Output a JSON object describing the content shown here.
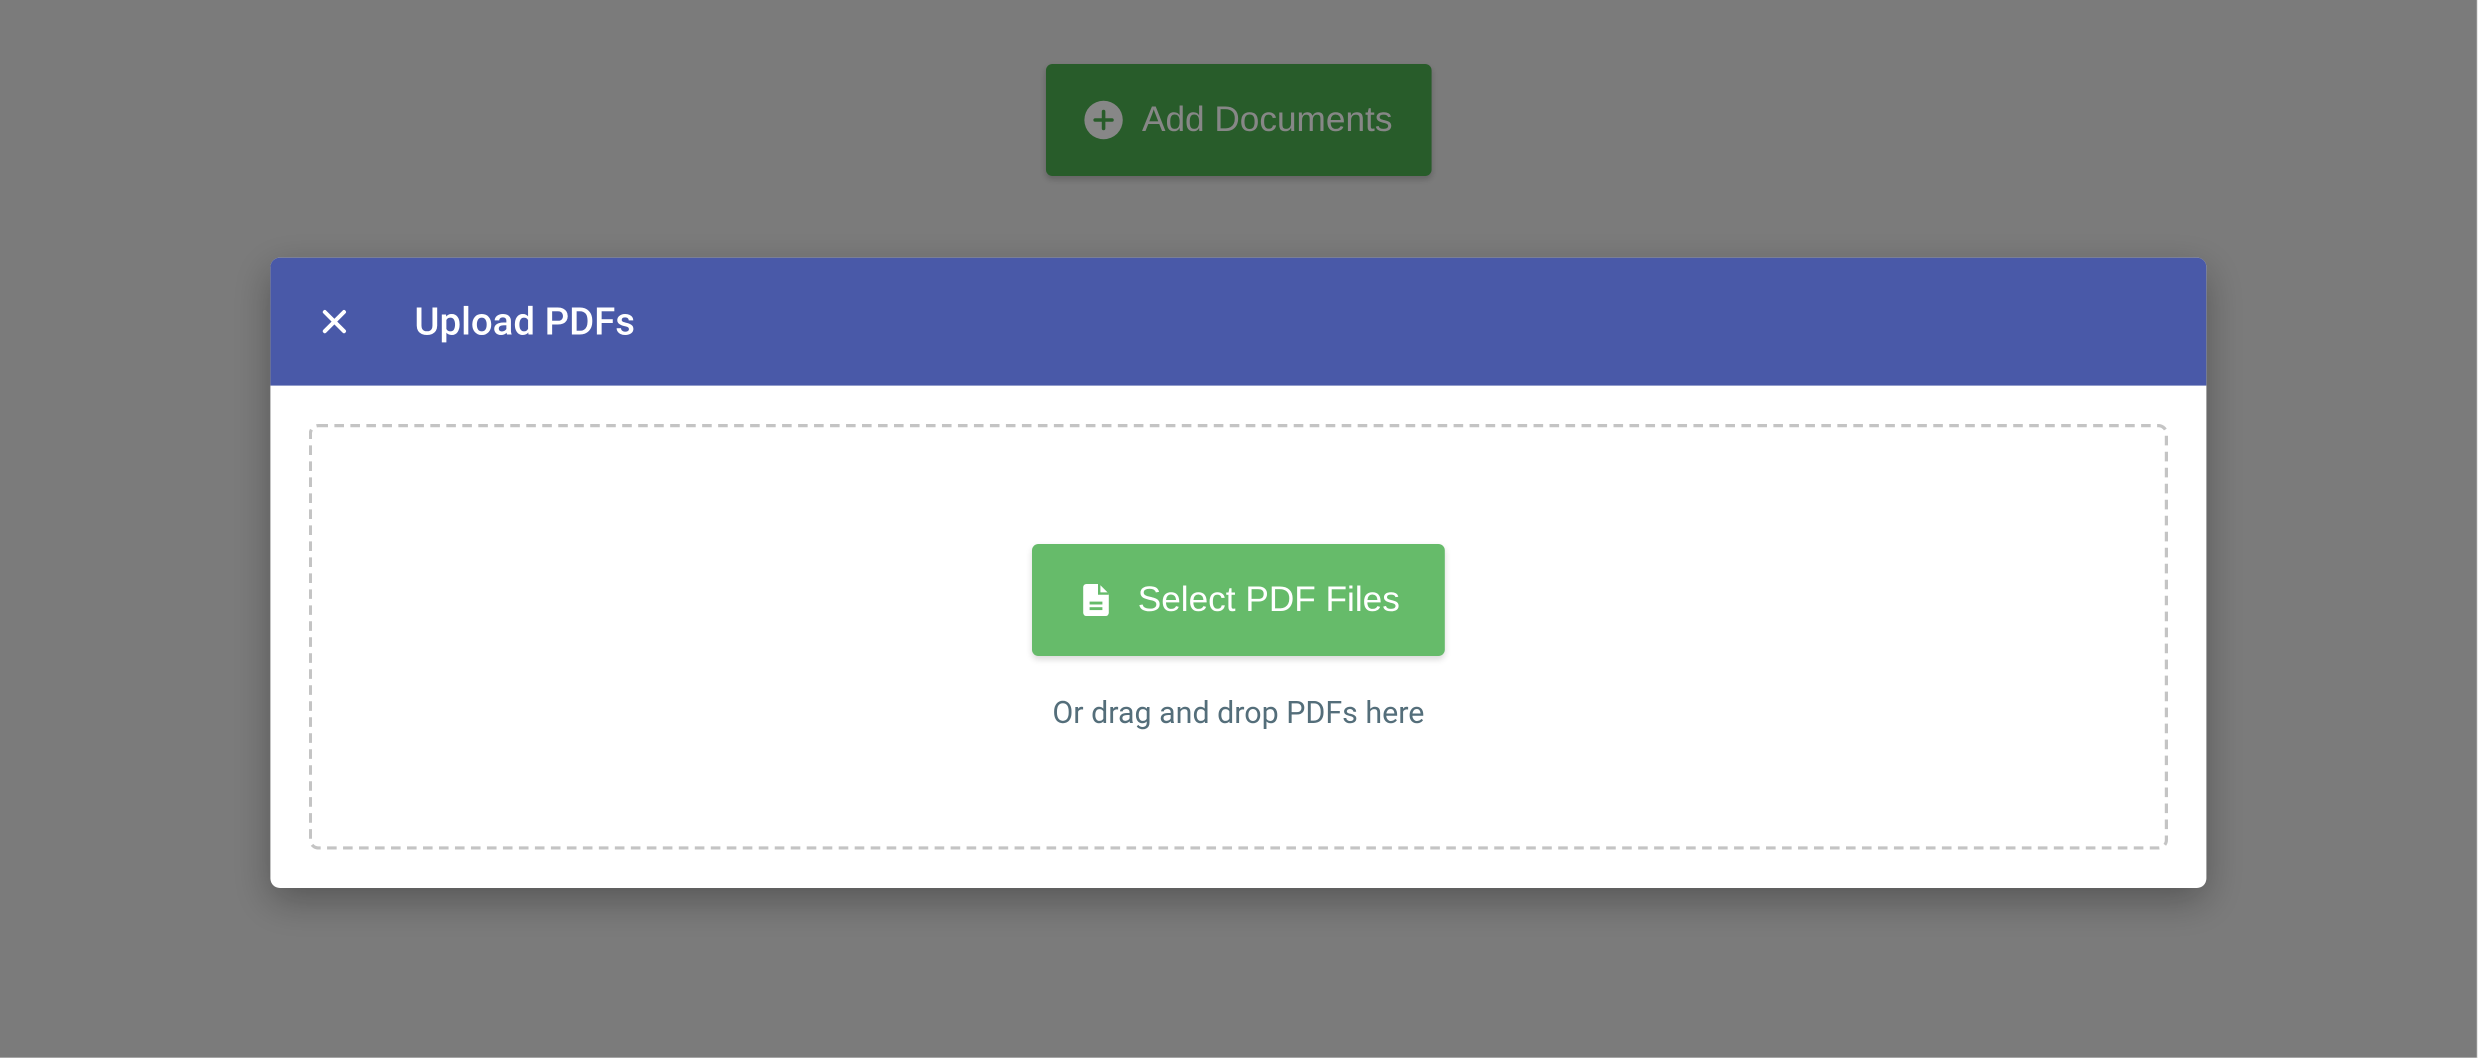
{
  "background_button": {
    "label": "Add Documents",
    "icon": "plus-circle"
  },
  "modal": {
    "title": "Upload PDFs",
    "close_icon": "close",
    "dropzone": {
      "select_button_label": "Select PDF Files",
      "select_button_icon": "file-document",
      "hint_text": "Or drag and drop PDFs here"
    }
  },
  "colors": {
    "primary_header": "#4959a8",
    "success_button": "#66BB6A",
    "add_button": "#4CAF50",
    "hint_text": "#546e7a",
    "border_dashed": "#c4c4c4"
  }
}
